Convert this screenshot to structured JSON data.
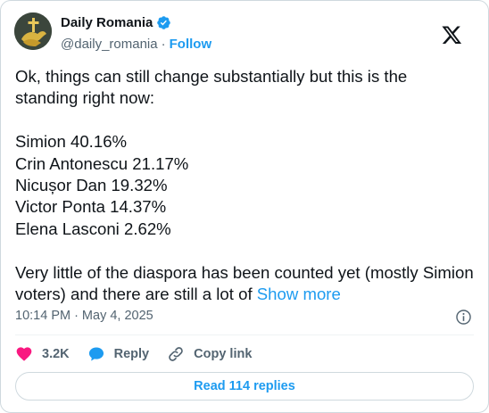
{
  "author": {
    "display_name": "Daily Romania",
    "handle": "@daily_romania",
    "separator": "·",
    "follow_label": "Follow",
    "verified": true,
    "avatar_icon": "cross-and-dove-avatar"
  },
  "platform_icon": "x-logo-icon",
  "post": {
    "text": "Ok, things can still change substantially but this is the standing right now:\n\nSimion 40.16%\nCrin Antonescu 21.17%\nNicușor Dan 19.32%\nVictor Ponta 14.37%\nElena Lasconi 2.62%\n\nVery little of the diaspora has been counted yet (mostly Simion voters) and there are still a lot of ",
    "show_more_label": "Show more",
    "time": "10:14 PM",
    "date_separator": "·",
    "date": "May 4, 2025"
  },
  "actions": {
    "likes_count": "3.2K",
    "reply_label": "Reply",
    "copy_link_label": "Copy link"
  },
  "read_replies_label": "Read 114 replies",
  "colors": {
    "accent": "#1d9bf0",
    "like": "#f91880",
    "muted": "#536471",
    "text": "#0f1419",
    "border": "#cfd9de"
  }
}
